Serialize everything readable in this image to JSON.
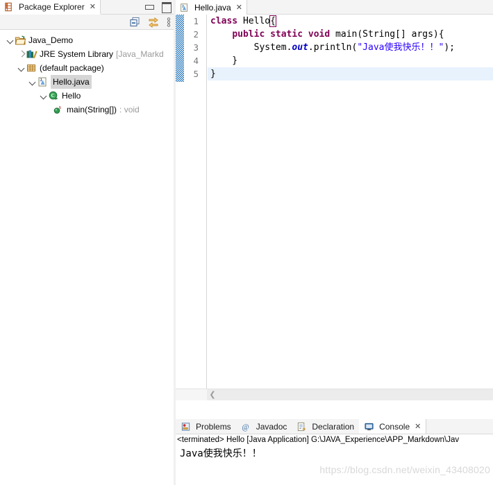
{
  "explorer": {
    "tab_label": "Package Explorer",
    "tab_close": "✕",
    "icon": "package-explorer-icon",
    "window_buttons": {
      "minimize": "minimize",
      "maximize": "maximize"
    },
    "toolbar": {
      "collapse_all": "Collapse All",
      "link_with_editor": "Link with Editor",
      "view_menu": "View Menu"
    },
    "tree": [
      {
        "label": "Java_Demo",
        "icon": "java-project-icon",
        "indent": 0,
        "arrow": "down",
        "selected": false,
        "dim": false
      },
      {
        "label": "JRE System Library",
        "icon": "library-icon",
        "indent": 1,
        "arrow": "right",
        "selected": false,
        "dim": false,
        "suffix": "[Java_Markd"
      },
      {
        "label": "(default package)",
        "icon": "package-icon",
        "indent": 1,
        "arrow": "down",
        "selected": false,
        "dim": false
      },
      {
        "label": "Hello.java",
        "icon": "java-file-icon",
        "indent": 2,
        "arrow": "down",
        "selected": true,
        "dim": false
      },
      {
        "label": "Hello",
        "icon": "java-class-icon",
        "indent": 3,
        "arrow": "down",
        "selected": false,
        "dim": false
      },
      {
        "label": "main(String[])",
        "icon": "method-static-icon",
        "indent": 4,
        "arrow": "none",
        "selected": false,
        "dim": false,
        "suffix": ": void"
      }
    ]
  },
  "editor": {
    "tab_label": "Hello.java",
    "tab_icon": "java-file-icon",
    "tab_close": "✕",
    "line_numbers": [
      "1",
      "2",
      "3",
      "4",
      "5"
    ],
    "fold_line": "2",
    "current_line": 5,
    "code": [
      {
        "n": 1,
        "tokens": [
          {
            "t": "class",
            "c": "kw"
          },
          {
            "t": " Hello",
            "c": "plain"
          },
          {
            "t": "{",
            "c": "brk"
          }
        ]
      },
      {
        "n": 2,
        "tokens": [
          {
            "t": "    ",
            "c": "plain"
          },
          {
            "t": "public",
            "c": "kw"
          },
          {
            "t": " ",
            "c": "plain"
          },
          {
            "t": "static",
            "c": "kw"
          },
          {
            "t": " ",
            "c": "plain"
          },
          {
            "t": "void",
            "c": "kw"
          },
          {
            "t": " main(String[] args){",
            "c": "plain"
          }
        ]
      },
      {
        "n": 3,
        "tokens": [
          {
            "t": "        System.",
            "c": "plain"
          },
          {
            "t": "out",
            "c": "fld"
          },
          {
            "t": ".println(",
            "c": "plain"
          },
          {
            "t": "\"Java使我快乐！！\"",
            "c": "str"
          },
          {
            "t": ");",
            "c": "plain"
          }
        ]
      },
      {
        "n": 4,
        "tokens": [
          {
            "t": "    }",
            "c": "plain"
          }
        ]
      },
      {
        "n": 5,
        "tokens": [
          {
            "t": "}",
            "c": "plain"
          }
        ]
      }
    ],
    "hscroll_left_arrow": "❮"
  },
  "bottom_panel": {
    "tabs": [
      {
        "label": "Problems",
        "icon": "problems-icon",
        "active": false
      },
      {
        "label": "Javadoc",
        "icon": "javadoc-icon",
        "active": false
      },
      {
        "label": "Declaration",
        "icon": "declaration-icon",
        "active": false
      },
      {
        "label": "Console",
        "icon": "console-icon",
        "active": true,
        "close": "✕"
      }
    ],
    "console_header": "<terminated> Hello [Java Application] G:\\JAVA_Experience\\APP_Markdown\\Jav",
    "console_output": "Java使我快乐！！",
    "watermark": "https://blog.csdn.net/weixin_43408020"
  },
  "colors": {
    "keyword": "#7f0055",
    "string": "#2a00ff",
    "field": "#0000c0",
    "current_line": "#e8f2fd",
    "selection": "#d6d6d6",
    "tab_bg": "#f4f4f4"
  }
}
